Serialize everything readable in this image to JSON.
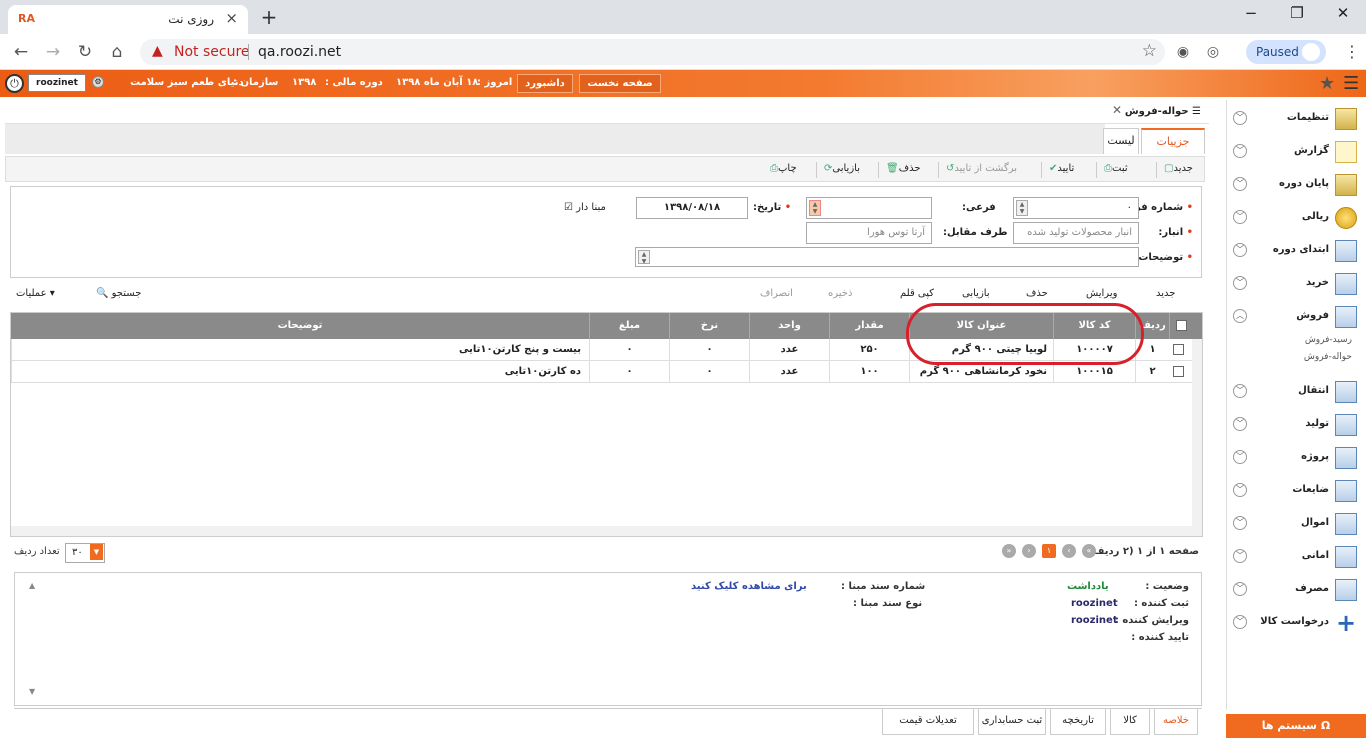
{
  "browser": {
    "tab_favicon": "RA",
    "tab_title": "روزی نت",
    "close_glyph": "×",
    "newtab_glyph": "+",
    "win_min": "−",
    "win_max": "❐",
    "win_close": "✕",
    "not_secure": "Not secure",
    "url": "qa.roozi.net",
    "paused": "Paused"
  },
  "appbar": {
    "user": "roozinet",
    "org_label": "سازمان :",
    "org_value": "دنیای طعم سبز سلامت",
    "fiscal_label": "دوره مالی :",
    "fiscal_value": "۱۳۹۸",
    "today_label": "امروز :",
    "today_value": "۱۸ آبان ماه ۱۳۹۸",
    "dashboard": "داشبورد",
    "home": "صفحه نخست"
  },
  "sidebar": {
    "items": [
      {
        "label": "تنظیمات",
        "icon": "settings-icon"
      },
      {
        "label": "گزارش",
        "icon": "report-icon"
      },
      {
        "label": "پایان دوره",
        "icon": "period-end-icon"
      },
      {
        "label": "ریالی",
        "icon": "coin-icon"
      },
      {
        "label": "ابتدای دوره",
        "icon": "period-start-icon"
      },
      {
        "label": "خرید",
        "icon": "purchase-icon"
      },
      {
        "label": "فروش",
        "icon": "sales-icon"
      },
      {
        "label": "انتقال",
        "icon": "transfer-icon"
      },
      {
        "label": "تولید",
        "icon": "production-icon"
      },
      {
        "label": "پروژه",
        "icon": "project-icon"
      },
      {
        "label": "ضایعات",
        "icon": "waste-icon"
      },
      {
        "label": "اموال",
        "icon": "assets-icon"
      },
      {
        "label": "امانی",
        "icon": "trust-icon"
      },
      {
        "label": "مصرف",
        "icon": "consumption-icon"
      },
      {
        "label": "درخواست کالا",
        "icon": "plus-icon"
      }
    ],
    "subitems": [
      "رسید-فروش",
      "حواله-فروش"
    ],
    "system": "سیستم ها"
  },
  "page": {
    "breadcrumb": "حواله-فروش",
    "tab_details": "جزییات",
    "tab_list": "لیست"
  },
  "toolbar1": [
    "جدید",
    "ثبت",
    "تایید",
    "برگشت از تایید",
    "حذف",
    "بازیابی",
    "چاپ"
  ],
  "form": {
    "form_no_label": "شماره فرم:",
    "form_no_value": "۰",
    "sub_label": "فرعی:",
    "date_label": "تاریخ:",
    "date_value": "۱۳۹۸/۰۸/۱۸",
    "has_base_label": "مبنا دار",
    "warehouse_label": "انبار:",
    "warehouse_value": "انبار محصولات تولید شده",
    "counterparty_label": "طرف مقابل:",
    "counterparty_value": "آرتا توس هورا",
    "desc_label": "توضیحات:"
  },
  "toolbar2": [
    "جدید",
    "ویرایش",
    "حذف",
    "بازیابی",
    "کپی قلم",
    "ذخیره",
    "انصراف"
  ],
  "toolbar2_left": {
    "search": "جستجو",
    "operations": "عملیات"
  },
  "grid": {
    "headers": {
      "row": "ردیف",
      "code": "کد کالا",
      "title": "عنوان کالا",
      "qty": "مقدار",
      "unit": "واحد",
      "rate": "نرخ",
      "amount": "مبلغ",
      "desc": "توضیحات"
    },
    "rows": [
      {
        "row": "۱",
        "code": "۱۰۰۰۰۷",
        "title": "لوبیا چیتی ۹۰۰ گرم",
        "qty": "۲۵۰",
        "unit": "عدد",
        "rate": "۰",
        "amount": "۰",
        "desc": "بیست و پنج کارتن۱۰تایی"
      },
      {
        "row": "۲",
        "code": "۱۰۰۰۱۵",
        "title": "نخود کرمانشاهی ۹۰۰ گرم",
        "qty": "۱۰۰",
        "unit": "عدد",
        "rate": "۰",
        "amount": "۰",
        "desc": "ده کارتن۱۰تایی"
      }
    ]
  },
  "pager": {
    "info": "صفحه ۱ از ۱ (۲ ردیف)",
    "current": "۱",
    "page_size": "۳۰",
    "page_size_label": "تعداد ردیف"
  },
  "summary": {
    "status_label": "وضعیت :",
    "status_value": "یادداشت",
    "creator_label": "ثبت کننده :",
    "creator_value": "roozinet",
    "editor_label": "ویرایش کننده :",
    "editor_value": "roozinet",
    "approver_label": "تایید کننده :",
    "base_no_label": "شماره سند مبنا :",
    "base_no_value": "برای مشاهده کلیک کنید",
    "base_type_label": "نوع سند مبنا :"
  },
  "bottom_tabs": [
    "خلاصه",
    "کالا",
    "تاریخچه",
    "ثبت حسابداری",
    "تعدیلات قیمت"
  ],
  "colors": {
    "accent": "#f06a1f",
    "highlight": "#d8202a",
    "link": "#2f4aa8",
    "status": "#1e8a3a"
  }
}
